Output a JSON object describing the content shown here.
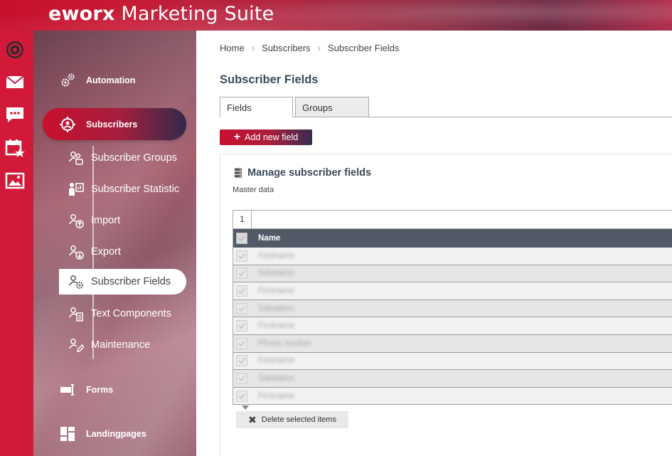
{
  "app": {
    "brand_bold": "eworx",
    "brand_rest": " Marketing Suite"
  },
  "colors": {
    "brand_red": "#c8102e",
    "grid_header": "#525a68",
    "sidebar_active_end": "#32294c"
  },
  "rail": {
    "icons": [
      "brand-logo-icon",
      "mail-icon",
      "chat-icon",
      "calendar-star-icon",
      "image-icon"
    ]
  },
  "sidebar": {
    "main": [
      {
        "label": "Automation",
        "icon": "gears-icon"
      },
      {
        "label": "Subscribers",
        "icon": "user-circle-icon",
        "active": true
      },
      {
        "label": "Forms",
        "icon": "form-icon"
      },
      {
        "label": "Landingpages",
        "icon": "layout-icon"
      }
    ],
    "sub": [
      {
        "label": "Subscriber Groups",
        "icon": "users-group-icon"
      },
      {
        "label": "Subscriber Statistic",
        "icon": "user-chart-icon"
      },
      {
        "label": "Import",
        "icon": "users-import-icon"
      },
      {
        "label": "Export",
        "icon": "users-export-icon"
      },
      {
        "label": "Subscriber Fields",
        "icon": "users-gear-icon",
        "active": true
      },
      {
        "label": "Text Components",
        "icon": "users-text-icon"
      },
      {
        "label": "Maintenance",
        "icon": "users-edit-icon"
      }
    ]
  },
  "breadcrumb": [
    "Home",
    "Subscribers",
    "Subscriber Fields"
  ],
  "page": {
    "title": "Subscriber Fields"
  },
  "tabs": [
    {
      "label": "Fields",
      "active": true
    },
    {
      "label": "Groups",
      "active": false
    }
  ],
  "actions": {
    "add_label": "Add new field",
    "delete_label": "Delete selected items"
  },
  "panel": {
    "title": "Manage subscriber fields",
    "subtitle": "Master data"
  },
  "grid": {
    "page": "1",
    "header": "Name",
    "rows": [
      "Firstname",
      "Salutation",
      "Firstname",
      "Salutation",
      "Firstname",
      "Phone number",
      "Firstname",
      "Salutation",
      "Firstname"
    ]
  }
}
